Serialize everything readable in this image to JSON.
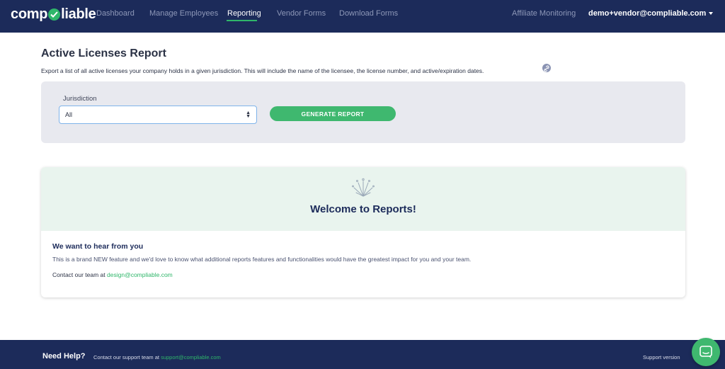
{
  "nav": {
    "logo_left": "comp",
    "logo_right": "liable",
    "links": [
      "Dashboard",
      "Manage Employees",
      "Reporting",
      "Vendor Forms",
      "Download Forms"
    ],
    "active_link": "Reporting",
    "affiliate_label": "Affiliate Monitoring",
    "user_email": "demo+vendor@compliable.com"
  },
  "header": {
    "title": "Active Licenses Report",
    "description": "Export a list of all active licenses your company holds in a given jurisdiction. This will include the name of the licensee, the license number, and active/expiration dates."
  },
  "filter": {
    "jurisdiction_label": "Jurisdiction",
    "jurisdiction_value": "All",
    "generate_label": "GENERATE REPORT"
  },
  "welcome": {
    "title": "Welcome to Reports!",
    "hear_title": "We want to hear from you",
    "hear_text": "This is a brand NEW feature and we'd love to know what additional reports features and functionalities would have the greatest impact for you and your team.",
    "contact_prefix": "Contact our team at",
    "contact_email": "design@compliable.com"
  },
  "footer": {
    "need_help": "Need Help?",
    "contact_prefix": "Contact our support team at",
    "contact_email": "support@compliable.com",
    "support_version": "Support version"
  },
  "colors": {
    "navy": "#1c2b5a",
    "accent_green": "#3fb86f",
    "panel_gray": "#e8e9ef",
    "banner_mint": "#e9f4ee"
  }
}
